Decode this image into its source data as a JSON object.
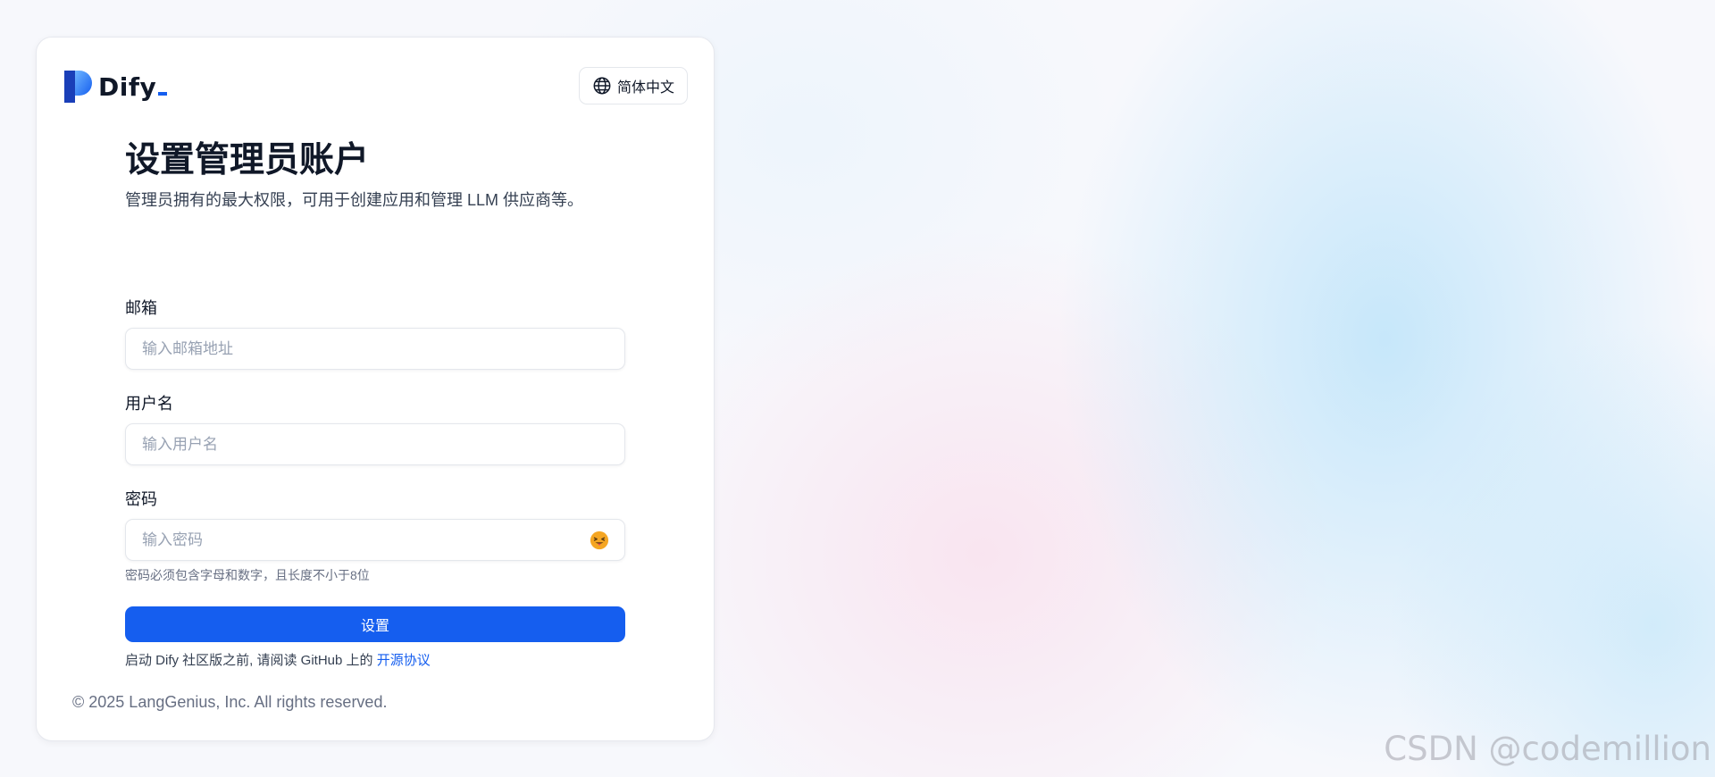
{
  "brand": {
    "name": "Dify",
    "logo_colors": [
      "#155eef",
      "#4d9bf5",
      "#1a3fb8"
    ]
  },
  "language_selector": {
    "icon": "globe-icon",
    "label": "简体中文"
  },
  "form": {
    "title": "设置管理员账户",
    "subtitle": "管理员拥有的最大权限，可用于创建应用和管理 LLM 供应商等。",
    "email": {
      "label": "邮箱",
      "placeholder": "输入邮箱地址",
      "value": ""
    },
    "username": {
      "label": "用户名",
      "placeholder": "输入用户名",
      "value": ""
    },
    "password": {
      "label": "密码",
      "placeholder": "输入密码",
      "value": "",
      "toggle_icon": "hide-password-emoji-icon",
      "hint": "密码必须包含字母和数字，且长度不小于8位"
    },
    "submit_label": "设置",
    "agreement_prefix": "启动 Dify 社区版之前, 请阅读 GitHub 上的",
    "agreement_link": "开源协议"
  },
  "footer": {
    "copyright": "© 2025 LangGenius, Inc. All rights reserved."
  },
  "watermark": "CSDN @codemillion",
  "colors": {
    "accent": "#155eef",
    "text_primary": "#101828",
    "text_secondary": "#354052",
    "placeholder": "#98a2b3"
  }
}
